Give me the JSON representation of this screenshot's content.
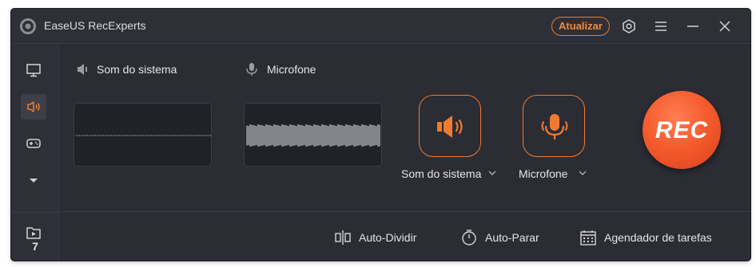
{
  "app": {
    "title": "EaseUS RecExperts",
    "update_label": "Atualizar"
  },
  "titlebar_icons": [
    "settings-icon",
    "menu-icon",
    "minimize-icon",
    "close-icon"
  ],
  "sidebar": {
    "items": [
      {
        "name": "screen-icon",
        "active": false
      },
      {
        "name": "audio-icon",
        "active": true
      },
      {
        "name": "game-icon",
        "active": false
      },
      {
        "name": "more-icon",
        "active": false
      }
    ],
    "recordings_count": "7"
  },
  "sections": {
    "system_sound": {
      "label": "Som do sistema"
    },
    "microphone": {
      "label": "Microfone"
    }
  },
  "sources": {
    "system_sound_label": "Som do sistema",
    "microphone_label": "Microfone"
  },
  "rec": {
    "label": "REC"
  },
  "bottom": {
    "auto_split": "Auto-Dividir",
    "auto_stop": "Auto-Parar",
    "scheduler": "Agendador de tarefas"
  },
  "colors": {
    "accent": "#f07b2e",
    "rec": "#f45a2c",
    "background": "#2b2c34"
  }
}
